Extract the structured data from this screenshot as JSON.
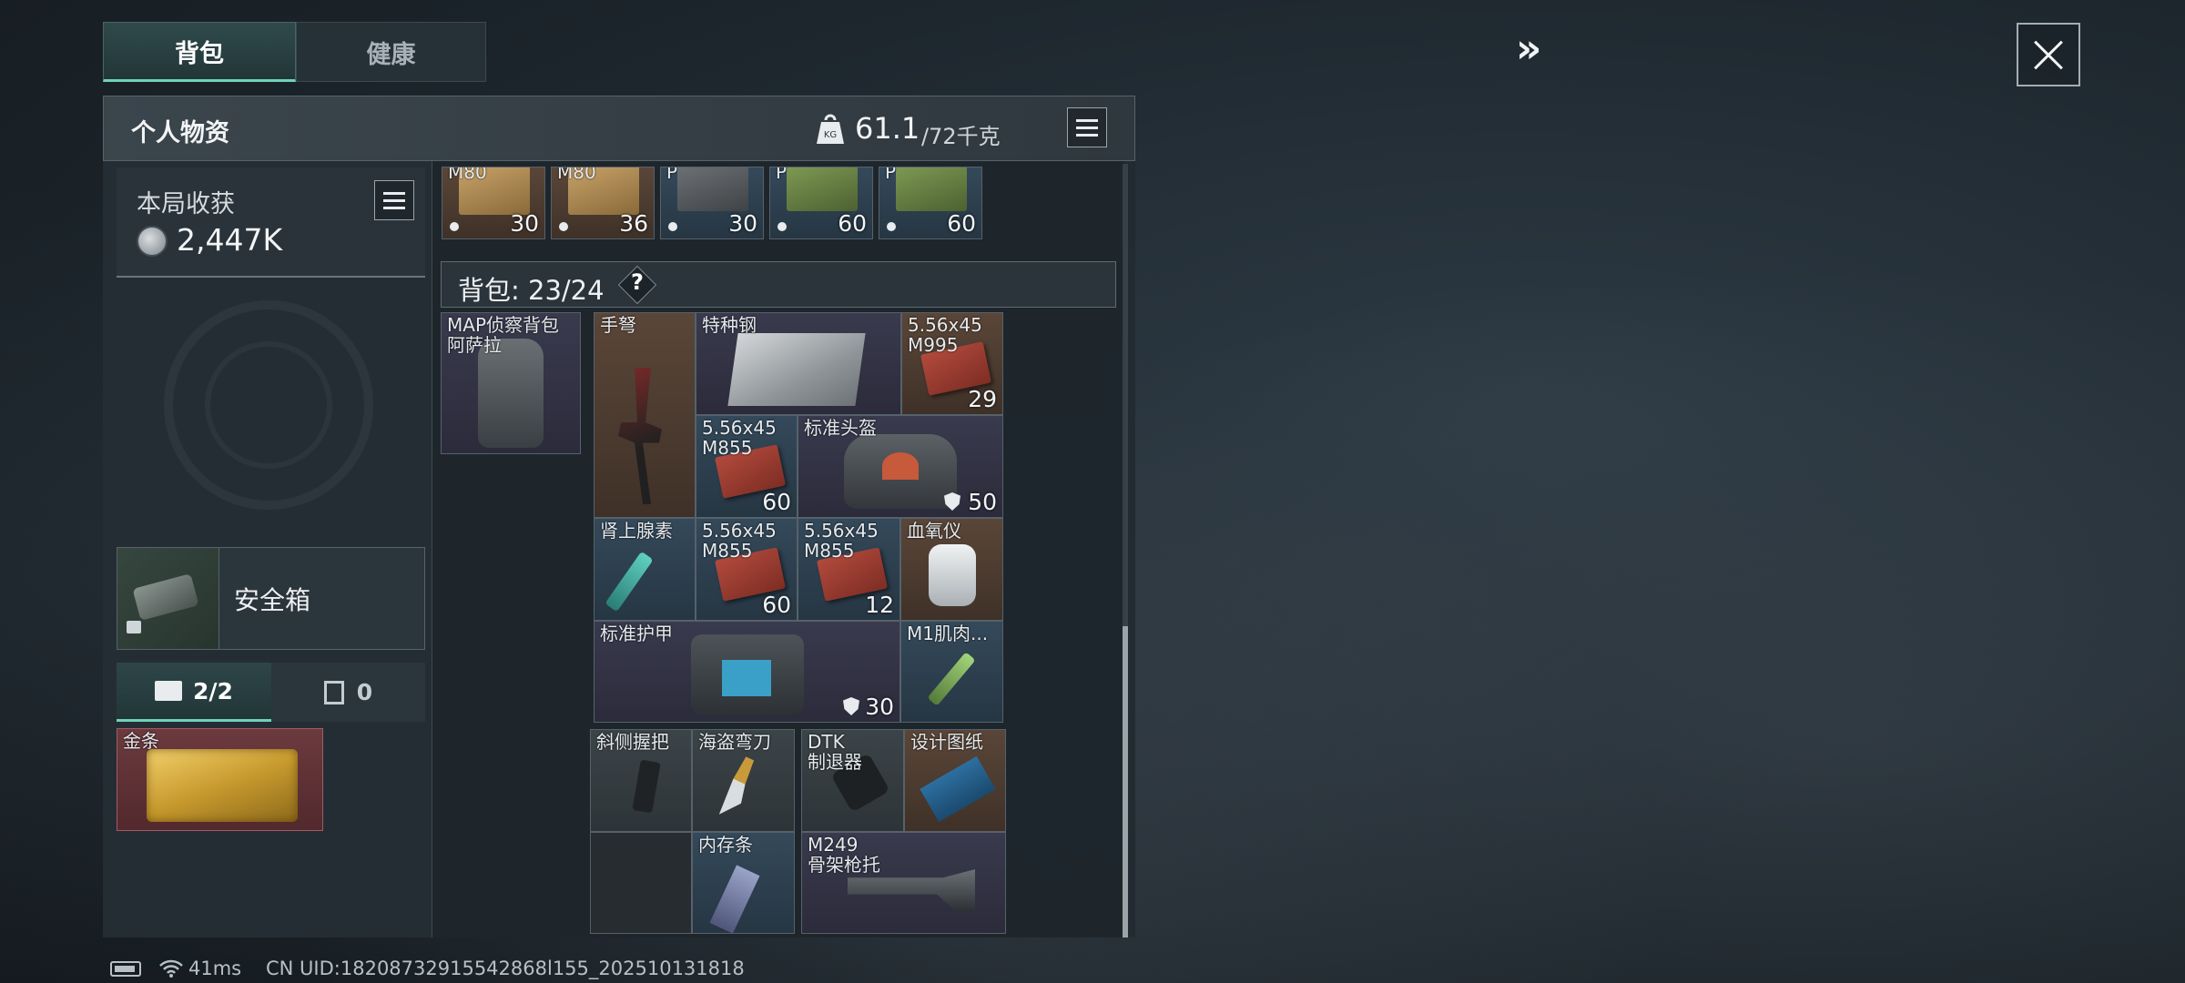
{
  "tabs": {
    "backpack": "背包",
    "health": "健康"
  },
  "header": {
    "title": "个人物资",
    "weight_current": "61.1",
    "weight_max": "/72千克",
    "weight_icon_text": "KG"
  },
  "harvest": {
    "label": "本局收获",
    "value": "2,447K"
  },
  "safebox": {
    "label": "安全箱"
  },
  "subtabs": {
    "tools_count": "2/2",
    "container_count": "0"
  },
  "gold": {
    "label": "金条"
  },
  "bag": {
    "title": "背包: 23/24",
    "help": "?"
  },
  "top_row": [
    {
      "label": "M80",
      "count": "30"
    },
    {
      "label": "M80",
      "count": "36"
    },
    {
      "label": "P",
      "count": "30"
    },
    {
      "label": "P",
      "count": "60"
    },
    {
      "label": "P",
      "count": "60"
    }
  ],
  "backpack_item": {
    "label": "MAP侦察背包\n阿萨拉"
  },
  "items": {
    "crossbow": {
      "label": "手弩"
    },
    "steel": {
      "label": "特种钢"
    },
    "ammo_m995": {
      "label": "5.56x45\nM995",
      "count": "29"
    },
    "ammo_m855_a": {
      "label": "5.56x45\nM855",
      "count": "60"
    },
    "helmet": {
      "label": "标准头盔",
      "durability": "50"
    },
    "adrenaline": {
      "label": "肾上腺素"
    },
    "ammo_m855_b": {
      "label": "5.56x45\nM855",
      "count": "60"
    },
    "ammo_m855_c": {
      "label": "5.56x45\nM855",
      "count": "12"
    },
    "oximeter": {
      "label": "血氧仪"
    },
    "armor": {
      "label": "标准护甲",
      "durability": "30"
    },
    "m1": {
      "label": "M1肌肉..."
    },
    "grip": {
      "label": "斜侧握把"
    },
    "knife": {
      "label": "海盗弯刀"
    },
    "dtk": {
      "label": "DTK\n制退器"
    },
    "blueprint": {
      "label": "设计图纸"
    },
    "ram": {
      "label": "内存条"
    },
    "stock": {
      "label": "M249\n骨架枪托"
    }
  },
  "footer": {
    "ping": "41ms",
    "uid": "CN UID:18208732915542868l155_202510131818"
  },
  "colors": {
    "accent": "#6fd3b9",
    "background": "#1d262d"
  }
}
